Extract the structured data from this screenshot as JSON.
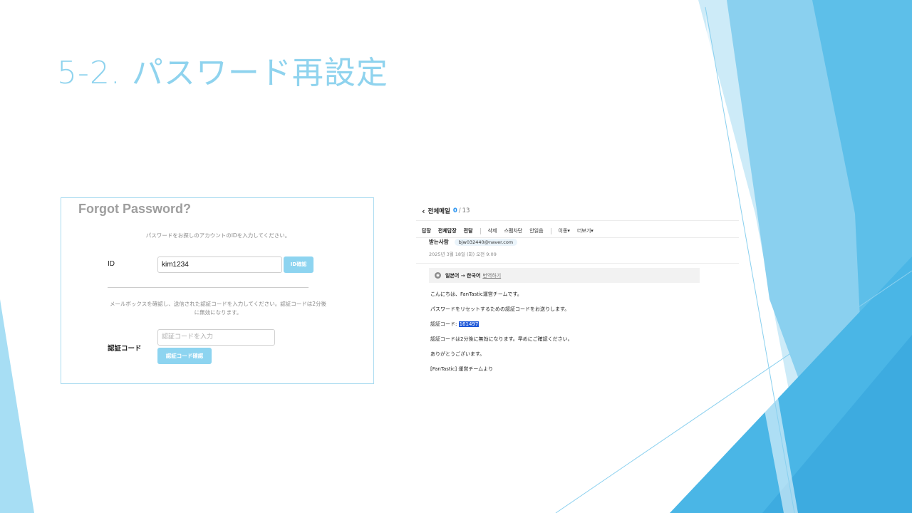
{
  "slide": {
    "title": "5-2. パスワード再設定",
    "colors": {
      "title": "#8fd3ee",
      "accent_light": "#a9dbf0",
      "accent_button": "#8dd4f0",
      "highlight": "#1e58d8"
    }
  },
  "forgot_password": {
    "heading": "Forgot Password?",
    "description": "パスワードをお探しのアカウントのIDを入力してください。",
    "id_label": "ID",
    "id_value": "kim1234",
    "id_confirm_button": "ID確認",
    "info_text": "メールボックスを確認し、送信された認証コードを入力してください。認証コードは2分後に無効になります。",
    "code_placeholder": "認証コードを入力",
    "code_label": "認証コード",
    "code_confirm_button": "認証コード確認"
  },
  "mail": {
    "folder": "전체메일",
    "unread": "0",
    "separator": "/",
    "total": "13",
    "toolbar": [
      "답장",
      "전체답장",
      "전달",
      "삭제",
      "스팸차단",
      "안읽음",
      "이동▾",
      "더보기▾"
    ],
    "recipient_label": "받는사람",
    "recipient": "bjw032440@naver.com",
    "date": "2025년 3월 18일 (화) 오전 9:09",
    "translate_langs": "일본어 → 한국어",
    "translate_link": "번역하기",
    "body": {
      "greeting": "こんにちは、FanTastic運営チームです。",
      "line1": "パスワードをリセットするための認証コードをお送りします。",
      "code_label": "認証コード: ",
      "code": "161497",
      "line2": "認証コードは2分後に無効になります。早めにご確認ください。",
      "thanks": "ありがとうございます。",
      "signature": "[FanTastic] 運営チームより"
    }
  }
}
